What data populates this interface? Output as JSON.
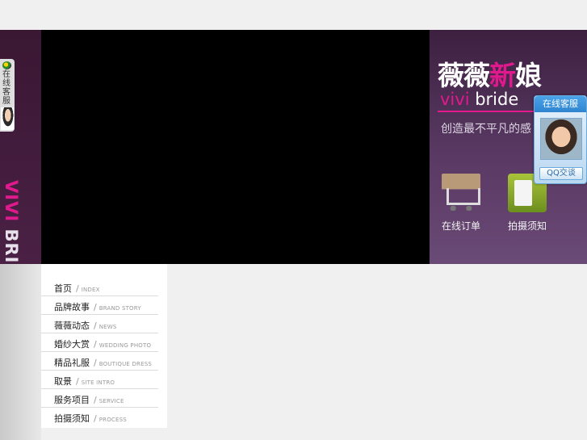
{
  "side_widget": {
    "label": "在线客服",
    "brand_text_vivi": "VIVI",
    "brand_text_bride": " BRIDE"
  },
  "banner": {
    "brand_cn_part1": "薇薇",
    "brand_cn_part2": "新",
    "brand_cn_part3": "娘",
    "brand_en_vivi": "vivi",
    "brand_en_rest": " bride",
    "slogan": "创造最不平凡的感",
    "buttons": [
      {
        "label": "在线订单",
        "icon": "shopping-cart-icon"
      },
      {
        "label": "拍摄须知",
        "icon": "clipboard-checklist-icon"
      }
    ],
    "accent_color": "#e0198c"
  },
  "chat_panel": {
    "title": "在线客服",
    "button_label": "QQ交谈"
  },
  "nav": {
    "items": [
      {
        "cn": "首页",
        "en": "INDEX"
      },
      {
        "cn": "品牌故事",
        "en": "BRAND STORY"
      },
      {
        "cn": "薇薇动态",
        "en": "NEWS"
      },
      {
        "cn": "婚纱大赏",
        "en": "WEDDING PHOTO"
      },
      {
        "cn": "精品礼服",
        "en": "BOUTIQUE DRESS"
      },
      {
        "cn": "取景",
        "en": "SITE INTRO"
      },
      {
        "cn": "服务项目",
        "en": "SERVICE"
      },
      {
        "cn": "拍摄须知",
        "en": "PROCESS"
      }
    ]
  }
}
